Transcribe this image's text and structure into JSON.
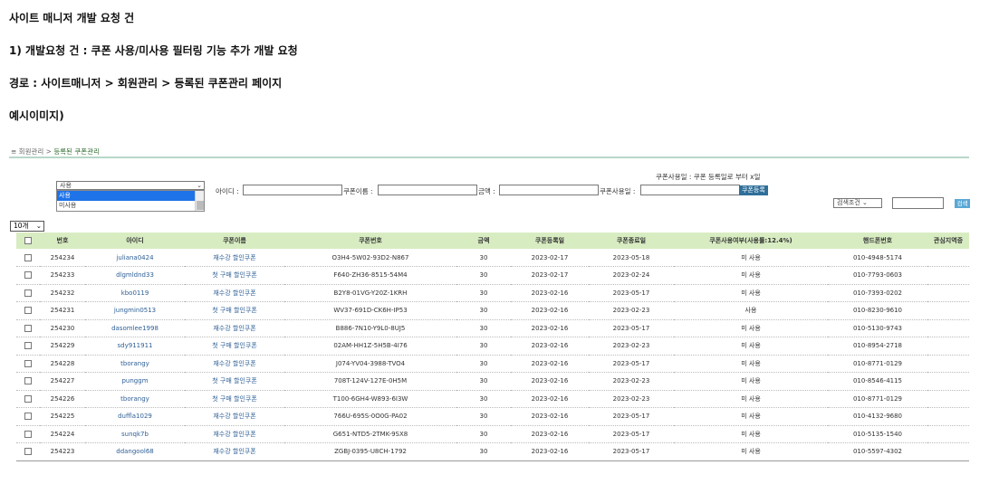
{
  "doc": {
    "title": "사이트 매니저 개발 요청 건",
    "request": "1) 개발요청 건 : 쿠폰 사용/미사용 필터링 기능 추가 개발 요청",
    "path": "경로 : 사이트매니저 > 회원관리 > 등록된 쿠폰관리 페이지",
    "example": "예시이미지)"
  },
  "breadcrumb": {
    "prefix": "≡ 회원관리 > ",
    "current": "등록된 쿠폰관리"
  },
  "coupon_note": "쿠폰사용일 : 쿠폰 등록일로 부터 x일",
  "filter": {
    "selected": "사용",
    "options": [
      "사용",
      "미사용"
    ]
  },
  "search": {
    "id_label": "아이디 :",
    "coupon_name_label": "쿠폰이름 :",
    "amount_label": "금액 :",
    "usage_date_label": "쿠폰사용일 :",
    "register_button": "쿠폰등록",
    "condition_select": "검색조건",
    "search_button": "검색"
  },
  "per_page": "10개",
  "table": {
    "headers": [
      "번호",
      "아이디",
      "쿠폰이름",
      "쿠폰번호",
      "금액",
      "쿠폰등록일",
      "쿠폰종료일",
      "쿠폰사용여부(사용률:12.4%)",
      "핸드폰번호",
      "관심지역증"
    ],
    "rows": [
      [
        "254234",
        "juliana0424",
        "재수강 할인쿠폰",
        "O3H4-5W02-93D2-N867",
        "30",
        "2023-02-17",
        "2023-05-18",
        "미 사용",
        "010-4948-5174",
        ""
      ],
      [
        "254233",
        "dlgmldnd33",
        "첫 구매 할인쿠폰",
        "F640-ZH36-8515-54M4",
        "30",
        "2023-02-17",
        "2023-02-24",
        "미 사용",
        "010-7793-0603",
        ""
      ],
      [
        "254232",
        "kbo0119",
        "재수강 할인쿠폰",
        "B2Y8-01VG-Y20Z-1KRH",
        "30",
        "2023-02-16",
        "2023-05-17",
        "미 사용",
        "010-7393-0202",
        ""
      ],
      [
        "254231",
        "jungmin0513",
        "첫 구매 할인쿠폰",
        "WV37-691D-CK6H-IP53",
        "30",
        "2023-02-16",
        "2023-02-23",
        "사용",
        "010-8230-9610",
        ""
      ],
      [
        "254230",
        "dasomlee1998",
        "재수강 할인쿠폰",
        "B886-7N10-Y9L0-8UJ5",
        "30",
        "2023-02-16",
        "2023-05-17",
        "미 사용",
        "010-5130-9743",
        ""
      ],
      [
        "254229",
        "sdy911911",
        "첫 구매 할인쿠폰",
        "02AM-HH1Z-5H5B-4I76",
        "30",
        "2023-02-16",
        "2023-02-23",
        "미 사용",
        "010-8954-2718",
        ""
      ],
      [
        "254228",
        "tborangy",
        "재수강 할인쿠폰",
        "J074-YV04-3988-TVO4",
        "30",
        "2023-02-16",
        "2023-05-17",
        "미 사용",
        "010-8771-0129",
        ""
      ],
      [
        "254227",
        "punggm",
        "첫 구매 할인쿠폰",
        "708T-124V-127E-0H5M",
        "30",
        "2023-02-16",
        "2023-02-23",
        "미 사용",
        "010-8546-4115",
        ""
      ],
      [
        "254226",
        "tborangy",
        "첫 구매 할인쿠폰",
        "T100-6GH4-W893-6I3W",
        "30",
        "2023-02-16",
        "2023-02-23",
        "미 사용",
        "010-8771-0129",
        ""
      ],
      [
        "254225",
        "duffla1029",
        "재수강 할인쿠폰",
        "766U-695S-0O0G-PA02",
        "30",
        "2023-02-16",
        "2023-05-17",
        "미 사용",
        "010-4132-9680",
        ""
      ],
      [
        "254224",
        "sunqk7b",
        "재수강 할인쿠폰",
        "G651-NTD5-2TMK-9SX8",
        "30",
        "2023-02-16",
        "2023-05-17",
        "미 사용",
        "010-5135-1540",
        ""
      ],
      [
        "254223",
        "ddangool68",
        "재수강 할인쿠폰",
        "ZGBJ-0395-U8CH-1792",
        "30",
        "2023-02-16",
        "2023-05-17",
        "미 사용",
        "010-5597-4302",
        ""
      ]
    ]
  }
}
